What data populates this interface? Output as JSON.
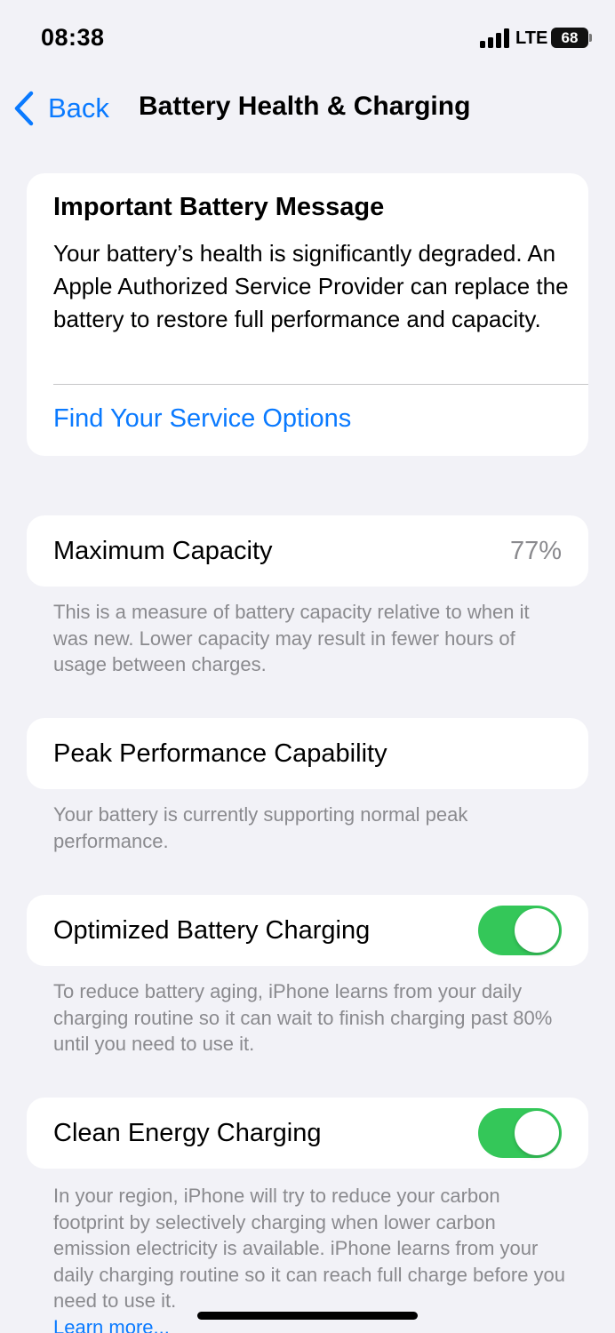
{
  "status_bar": {
    "time": "08:38",
    "network": "LTE",
    "battery": "68"
  },
  "nav": {
    "back_label": "Back",
    "title": "Battery Health & Charging"
  },
  "message_card": {
    "title": "Important Battery Message",
    "body": "Your battery’s health is significantly degraded. An Apple Authorized Service Provider can replace the battery to restore full performance and capacity.",
    "link": "Find Your Service Options"
  },
  "maximum_capacity": {
    "label": "Maximum Capacity",
    "value": "77%",
    "footnote": "This is a measure of battery capacity relative to when it was new. Lower capacity may result in fewer hours of usage between charges."
  },
  "peak_performance": {
    "label": "Peak Performance Capability",
    "footnote": "Your battery is currently supporting normal peak performance."
  },
  "optimized_charging": {
    "label": "Optimized Battery Charging",
    "enabled": true,
    "footnote": "To reduce battery aging, iPhone learns from your daily charging routine so it can wait to finish charging past 80% until you need to use it."
  },
  "clean_energy": {
    "label": "Clean Energy Charging",
    "enabled": true,
    "footnote": "In your region, iPhone will try to reduce your carbon footprint by selectively charging when lower carbon emission electricity is available. iPhone learns from your daily charging routine so it can reach full charge before you need to use it.",
    "learn_more": "Learn more..."
  },
  "colors": {
    "accent": "#0a7aff",
    "toggle_on": "#34c759",
    "background": "#f2f2f7",
    "secondary_text": "#8a8a8e"
  }
}
